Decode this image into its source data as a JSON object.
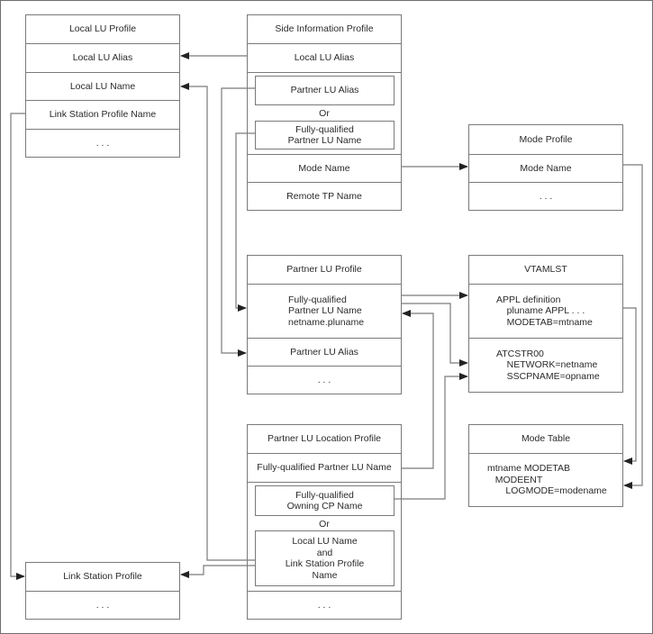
{
  "local_lu_profile": {
    "title": "Local LU Profile",
    "fields": [
      "Local LU Alias",
      "Local LU Name",
      "Link Station Profile Name",
      ". . ."
    ]
  },
  "side_information_profile": {
    "title": "Side Information Profile",
    "local_lu_alias": "Local LU Alias",
    "partner_lu_alias": "Partner LU Alias",
    "or_label": "Or",
    "fq_partner_lu_name": "Fully-qualified\nPartner LU Name",
    "mode_name": "Mode Name",
    "remote_tp_name": "Remote TP Name"
  },
  "mode_profile": {
    "title": "Mode Profile",
    "fields": [
      "Mode Name",
      ". . ."
    ]
  },
  "partner_lu_profile": {
    "title": "Partner LU Profile",
    "fq_name": "Fully-qualified\nPartner LU Name\nnetname.pluname",
    "alias": "Partner LU Alias",
    "more": ". . ."
  },
  "vtamlst": {
    "title": "VTAMLST",
    "appl_definition": "APPL definition\n    pluname APPL . . .\n    MODETAB=mtname",
    "atcstr00": "ATCSTR00\n    NETWORK=netname\n    SSCPNAME=opname"
  },
  "mode_table": {
    "title": "Mode Table",
    "body": "mtname MODETAB\n   MODEENT\n       LOGMODE=modename"
  },
  "partner_lu_location_profile": {
    "title": "Partner LU Location Profile",
    "fq_partner_lu_name": "Fully-qualified Partner LU Name",
    "fq_owning_cp_name": "Fully-qualified\nOwning CP Name",
    "or_label": "Or",
    "local_lu_and_link": "Local LU Name\nand\nLink Station Profile\nName",
    "more": ". . ."
  },
  "link_station_profile": {
    "title": "Link Station Profile",
    "more": ". . ."
  }
}
